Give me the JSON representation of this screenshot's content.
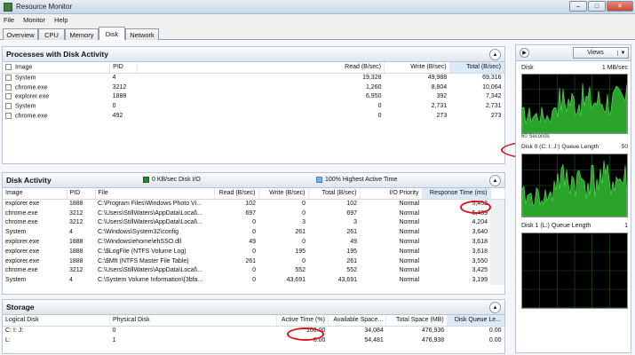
{
  "window": {
    "title": "Resource Monitor"
  },
  "menu": [
    "File",
    "Monitor",
    "Help"
  ],
  "tabs": [
    "Overview",
    "CPU",
    "Memory",
    "Disk",
    "Network"
  ],
  "processes": {
    "title": "Processes with Disk Activity",
    "columns": [
      "Image",
      "PID",
      "Read (B/sec)",
      "Write (B/sec)",
      "Total (B/sec)"
    ],
    "rows": [
      [
        "System",
        "4",
        "19,328",
        "49,988",
        "69,316"
      ],
      [
        "chrome.exe",
        "3212",
        "1,260",
        "8,804",
        "10,064"
      ],
      [
        "explorer.exe",
        "1888",
        "6,950",
        "392",
        "7,342"
      ],
      [
        "System",
        "0",
        "0",
        "2,731",
        "2,731"
      ],
      [
        "chrome.exe",
        "492",
        "0",
        "273",
        "273"
      ]
    ]
  },
  "disk_activity": {
    "title": "Disk Activity",
    "legend_io": "0 KB/sec Disk I/O",
    "legend_active": "100% Highest Active Time",
    "colors": {
      "io": "#2a8a2a",
      "active": "#7ab2e8"
    },
    "columns": [
      "Image",
      "PID",
      "File",
      "Read (B/sec)",
      "Write (B/sec)",
      "Total (B/sec)",
      "I/O Priority",
      "Response Time (ms)"
    ],
    "rows": [
      [
        "explorer.exe",
        "1888",
        "C:\\Program Files\\Windows Photo Vi...",
        "102",
        "0",
        "102",
        "Normal",
        "5,452"
      ],
      [
        "chrome.exe",
        "3212",
        "C:\\Users\\StillWaters\\AppData\\Local\\...",
        "697",
        "0",
        "697",
        "Normal",
        "5,439"
      ],
      [
        "chrome.exe",
        "3212",
        "C:\\Users\\StillWaters\\AppData\\Local\\...",
        "0",
        "3",
        "3",
        "Normal",
        "4,204"
      ],
      [
        "System",
        "4",
        "C:\\Windows\\System32\\config",
        "0",
        "261",
        "261",
        "Normal",
        "3,640"
      ],
      [
        "explorer.exe",
        "1888",
        "C:\\Windows\\ehome\\ehSSO.dll",
        "49",
        "0",
        "49",
        "Normal",
        "3,618"
      ],
      [
        "explorer.exe",
        "1888",
        "C:\\$LogFile (NTFS Volume Log)",
        "0",
        "195",
        "195",
        "Normal",
        "3,618"
      ],
      [
        "explorer.exe",
        "1888",
        "C:\\$Mft (NTFS Master File Table)",
        "261",
        "0",
        "261",
        "Normal",
        "3,550"
      ],
      [
        "chrome.exe",
        "3212",
        "C:\\Users\\StillWaters\\AppData\\Local\\...",
        "0",
        "552",
        "552",
        "Normal",
        "3,425"
      ],
      [
        "System",
        "4",
        "C:\\System Volume Information\\{3bfa...",
        "0",
        "43,691",
        "43,691",
        "Normal",
        "3,199"
      ]
    ]
  },
  "storage": {
    "title": "Storage",
    "columns": [
      "Logical Disk",
      "Physical Disk",
      "Active Time (%)",
      "Available Space...",
      "Total Space (MB)",
      "Disk Queue Le..."
    ],
    "rows": [
      [
        "C: I: J:",
        "0",
        "100.00",
        "34,084",
        "476,936",
        "0.00"
      ],
      [
        "L:",
        "1",
        "0.00",
        "54,481",
        "476,938",
        "0.00"
      ]
    ]
  },
  "right_pane": {
    "views_label": "Views",
    "graphs": [
      {
        "name": "Disk",
        "scale": "1 MB/sec",
        "footer": "60 Seconds"
      },
      {
        "name": "Disk 0 (C: I: J:) Queue Length",
        "scale": "50"
      },
      {
        "name": "Disk 1 (L:) Queue Length",
        "scale": "1"
      }
    ]
  }
}
